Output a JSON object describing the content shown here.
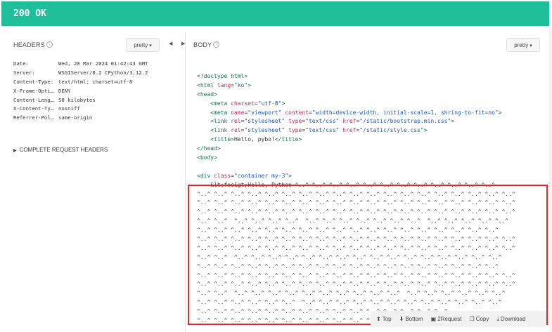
{
  "status": "200 OK",
  "headers_panel": {
    "title": "HEADERS",
    "info_icon": "info-icon",
    "format_label": "pretty",
    "rows": [
      {
        "key": "Date:",
        "value": "Wed, 20 Mar 2024 01:42:43 GMT"
      },
      {
        "key": "Server:",
        "value": "WSGIServer/0.2 CPython/3.12.2"
      },
      {
        "key": "Content-Type:",
        "value": "text/html; charset=utf-8"
      },
      {
        "key": "X-Frame-Opti…",
        "value": "DENY"
      },
      {
        "key": "Content-Leng…",
        "value": "50 kilobytes"
      },
      {
        "key": "X-Content-Ty…",
        "value": "nosniff"
      },
      {
        "key": "Referrer-Pol…",
        "value": "same-origin"
      }
    ],
    "complete_request_label": "COMPLETE REQUEST HEADERS"
  },
  "splitter": {
    "left_arrow": "◀",
    "right_arrow": "▶"
  },
  "body_panel": {
    "title": "BODY",
    "format_label": "pretty",
    "code_lines": [
      [
        {
          "t": "tag",
          "v": "<!doctype html>"
        }
      ],
      [
        {
          "t": "tag",
          "v": "<html "
        },
        {
          "t": "attr",
          "v": "lang"
        },
        {
          "t": "plain",
          "v": "="
        },
        {
          "t": "str",
          "v": "\"ko\""
        },
        {
          "t": "tag",
          "v": ">"
        }
      ],
      [
        {
          "t": "tag",
          "v": "<head>"
        }
      ],
      [
        {
          "t": "plain",
          "v": "    "
        },
        {
          "t": "tag",
          "v": "<meta "
        },
        {
          "t": "attr",
          "v": "charset"
        },
        {
          "t": "plain",
          "v": "="
        },
        {
          "t": "str",
          "v": "\"utf-8\""
        },
        {
          "t": "tag",
          "v": ">"
        }
      ],
      [
        {
          "t": "plain",
          "v": "    "
        },
        {
          "t": "tag",
          "v": "<meta "
        },
        {
          "t": "attr",
          "v": "name"
        },
        {
          "t": "plain",
          "v": "="
        },
        {
          "t": "str",
          "v": "\"viewport\""
        },
        {
          "t": "plain",
          "v": " "
        },
        {
          "t": "attr",
          "v": "content"
        },
        {
          "t": "plain",
          "v": "="
        },
        {
          "t": "str",
          "v": "\"width=device-width, initial-scale=1, shring-to-fit=no\""
        },
        {
          "t": "tag",
          "v": ">"
        }
      ],
      [
        {
          "t": "plain",
          "v": "    "
        },
        {
          "t": "tag",
          "v": "<link "
        },
        {
          "t": "attr",
          "v": "rel"
        },
        {
          "t": "plain",
          "v": "="
        },
        {
          "t": "str",
          "v": "\"stylesheet\""
        },
        {
          "t": "plain",
          "v": " "
        },
        {
          "t": "attr",
          "v": "type"
        },
        {
          "t": "plain",
          "v": "="
        },
        {
          "t": "str",
          "v": "\"text/css\""
        },
        {
          "t": "plain",
          "v": " "
        },
        {
          "t": "attr",
          "v": "href"
        },
        {
          "t": "plain",
          "v": "="
        },
        {
          "t": "str",
          "v": "\"/static/bootstrap.min.css\""
        },
        {
          "t": "tag",
          "v": ">"
        }
      ],
      [
        {
          "t": "plain",
          "v": "    "
        },
        {
          "t": "tag",
          "v": "<link "
        },
        {
          "t": "attr",
          "v": "rel"
        },
        {
          "t": "plain",
          "v": "="
        },
        {
          "t": "str",
          "v": "\"stylesheet\""
        },
        {
          "t": "plain",
          "v": " "
        },
        {
          "t": "attr",
          "v": "type"
        },
        {
          "t": "plain",
          "v": "="
        },
        {
          "t": "str",
          "v": "\"text/css\""
        },
        {
          "t": "plain",
          "v": " "
        },
        {
          "t": "attr",
          "v": "href"
        },
        {
          "t": "plain",
          "v": "="
        },
        {
          "t": "str",
          "v": "\"/static/style.css\""
        },
        {
          "t": "tag",
          "v": ">"
        }
      ],
      [
        {
          "t": "plain",
          "v": "    "
        },
        {
          "t": "tag",
          "v": "<title>"
        },
        {
          "t": "plain",
          "v": "Hello, pybo!"
        },
        {
          "t": "tag",
          "v": "</title>"
        }
      ],
      [
        {
          "t": "tag",
          "v": "</head>"
        }
      ],
      [
        {
          "t": "tag",
          "v": "<body>"
        }
      ],
      [
        {
          "t": "plain",
          "v": ""
        }
      ],
      [
        {
          "t": "tag",
          "v": "<div "
        },
        {
          "t": "attr",
          "v": "class"
        },
        {
          "t": "plain",
          "v": "="
        },
        {
          "t": "str",
          "v": "\"container my-3\""
        },
        {
          "t": "tag",
          "v": ">"
        }
      ],
      [
        {
          "t": "plain",
          "v": "    &lt;foo&gt;Hello, Python ^..^ ^..^ ^..^ ^..^ ^..^ ^..^ ^..^ ^..^ ^..^ ^..^ ^..^ ^..^"
        }
      ],
      [
        {
          "t": "plain",
          "v": "^..^ ^..^ ^..^ ^..^ ^..^ ^..^ ^..^ ^..^ ^..^ ^..^ ^..^ ^..^ ^..^ ^..^ ^..^ ^..^ ^..^ ^..^ ^..^"
        }
      ],
      [
        {
          "t": "plain",
          "v": "^..^ ^..^ ^..^ ^..^ ^..^ ^..^ ^..^ ^..^ ^..^ ^..^ ^..^ ^..^ ^..^ ^..^ ^..^ ^..^ ^..^ ^..^ ^..^"
        }
      ],
      [
        {
          "t": "plain",
          "v": "^..^ ^..^ ^..^ ^..^ ^..^ ^..^ ^..^ ^..^ ^..^ ^..^ ^..^ ^..^ ^..^ ^..^ ^..^ ^..^ ^..^ ^..^ ^..^"
        }
      ],
      [
        {
          "t": "plain",
          "v": "^..^ ^..^  ^..^ ^..^ ^..^ ^..^  ^..^ ^..^ ^..^ ^..^ ^..^ ^..^ ^..^  ^..^ ^..^ ^..^ ^..^ ^..^"
        }
      ],
      [
        {
          "t": "plain",
          "v": "^..^ ^..^ ^..^ ^..^ ^..^ ^..^ ^..^ ^..^ ^..^ ^..^ ^..^ ^..^ ^..^ ^..^ ^..^ ^..^ ^..^ ^..^"
        }
      ],
      [
        {
          "t": "plain",
          "v": "^..^ ^..^ ^..^ ^..^ ^..^ ^..^ ^..^ ^..^ ^..^ ^..^ ^..^ ^..^ ^..^ ^..^ ^..^ ^..^ ^..^ ^..^ ^..^"
        }
      ],
      [
        {
          "t": "plain",
          "v": "^..^ ^..^ ^..^ ^..^ ^..^ ^..^ ^..^ ^..^ ^..^ ^..^ ^..^ ^..^ ^..^ ^..^ ^..^ ^..^ ^..^ ^..^ ^..^"
        }
      ],
      [
        {
          "t": "plain",
          "v": "^..^ ^..^  ^..^ ^..^ ^..^ ^..^ ^..^ ^..^ ^..^ ^..^ ^..^ ^..^ ^..^ ^..^ ^..^ ^..^ ^..^ ^..^"
        }
      ],
      [
        {
          "t": "plain",
          "v": "^..^ ^..^ ^..^ ^..^ ^..^ ^..^ ^..^ ^..^ ^..^ ^..^ ^..^ ^..^ ^..^ ^..^ ^..^ ^..^ ^..^ ^..^"
        }
      ],
      [
        {
          "t": "plain",
          "v": "^..^ ^..^ ^..^ ^..^ ^..^ ^..^ ^..^ ^..^ ^..^ ^..^ ^..^ ^..^ ^..^ ^..^ ^..^ ^..^ ^..^ ^..^ ^..^"
        }
      ],
      [
        {
          "t": "plain",
          "v": "^..^ ^..^ ^..^ ^..^ ^..^ ^..^ ^..^ ^..^ ^..^ ^..^ ^..^ ^..^ ^..^ ^..^ ^..^ ^..^ ^..^ ^..^ ^..^"
        }
      ],
      [
        {
          "t": "plain",
          "v": "^..^ ^..^  ^..^ ^..^ ^..^ ^..^ ^..^ ^..^ ^..^ ^..^ ^..^ ^..^  ^..^ ^..^ ^..^ ^..^ ^..^ ^..^"
        }
      ],
      [
        {
          "t": "plain",
          "v": "^..^ ^..^ ^..^ ^..^ ^..^ ^..^  ^..^ ^..^ ^..^ ^..^ ^..^ ^..^ ^..^ ^..^ ^..^ ^..^ ^..^ ^..^"
        }
      ],
      [
        {
          "t": "plain",
          "v": "^..^ ^..^ ^..^ ^..^ ^..^ ^..^ ^..^ ^..^ ^..^ ^..^ ^..^ ^..^ ^..^ ^..^ ^..^"
        }
      ],
      [
        {
          "t": "plain",
          "v": "^..^ ^..^ ^..^ ^..^ ^..^ ^..^ ^..^ ^..^ ^..^ ^..^ ^..^"
        }
      ]
    ]
  },
  "toolbar": {
    "top": {
      "icon": "up-circle-icon",
      "label": "Top"
    },
    "bottom": {
      "icon": "down-circle-icon",
      "label": "Bottom"
    },
    "to_request": {
      "icon": "request-icon",
      "label": "2Request"
    },
    "copy": {
      "icon": "copy-icon",
      "label": "Copy"
    },
    "download": {
      "icon": "download-icon",
      "label": "Download"
    }
  },
  "colors": {
    "status_bar": "#1fbf9a",
    "selection_border": "#e0282e"
  }
}
